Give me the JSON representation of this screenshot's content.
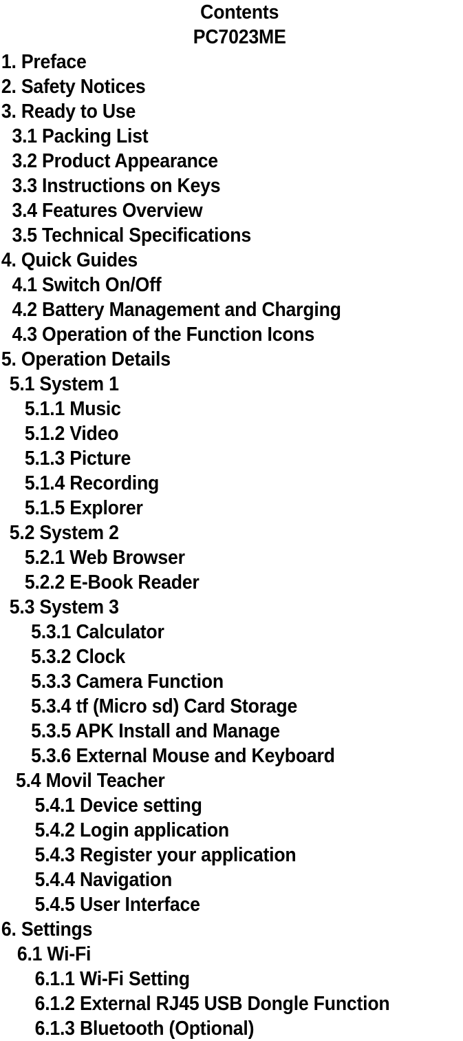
{
  "document": {
    "title": "Contents",
    "model": "PC7023ME"
  },
  "toc": {
    "entries": [
      {
        "label": "1. Preface",
        "indent": "lvl-0"
      },
      {
        "label": "2. Safety Notices",
        "indent": "lvl-0"
      },
      {
        "label": "3. Ready to Use",
        "indent": "lvl-0"
      },
      {
        "label": "3.1 Packing List",
        "indent": "lvl-1"
      },
      {
        "label": "3.2 Product Appearance",
        "indent": "lvl-1"
      },
      {
        "label": "3.3 Instructions on Keys",
        "indent": "lvl-1"
      },
      {
        "label": "3.4 Features Overview",
        "indent": "lvl-1"
      },
      {
        "label": "3.5 Technical Specifications",
        "indent": "lvl-1"
      },
      {
        "label": "4. Quick Guides",
        "indent": "lvl-0"
      },
      {
        "label": "4.1 Switch On/Off",
        "indent": "lvl-1"
      },
      {
        "label": "4.2 Battery Management and Charging",
        "indent": "lvl-1"
      },
      {
        "label": "4.3 Operation of the Function Icons",
        "indent": "lvl-1"
      },
      {
        "label": "5. Operation Details",
        "indent": "lvl-0"
      },
      {
        "label": "5.1 System 1",
        "indent": "lvl-1b"
      },
      {
        "label": "5.1.1 Music",
        "indent": "lvl-2"
      },
      {
        "label": "5.1.2 Video",
        "indent": "lvl-2"
      },
      {
        "label": "5.1.3 Picture",
        "indent": "lvl-2"
      },
      {
        "label": "5.1.4 Recording",
        "indent": "lvl-2"
      },
      {
        "label": "5.1.5 Explorer",
        "indent": "lvl-2"
      },
      {
        "label": "5.2 System 2",
        "indent": "lvl-1b"
      },
      {
        "label": "5.2.1 Web Browser",
        "indent": "lvl-2"
      },
      {
        "label": "5.2.2 E-Book Reader",
        "indent": "lvl-2"
      },
      {
        "label": "5.3 System 3",
        "indent": "lvl-1b"
      },
      {
        "label": "5.3.1 Calculator",
        "indent": "lvl-2b"
      },
      {
        "label": "5.3.2 Clock",
        "indent": "lvl-2b"
      },
      {
        "label": "5.3.3 Camera Function",
        "indent": "lvl-2b"
      },
      {
        "label": "5.3.4 tf (Micro sd) Card Storage",
        "indent": "lvl-2b"
      },
      {
        "label": "5.3.5 APK Install and Manage",
        "indent": "lvl-2b"
      },
      {
        "label": "5.3.6 External Mouse and Keyboard",
        "indent": "lvl-2b"
      },
      {
        "label": "5.4 Movil Teacher",
        "indent": "lvl-1d"
      },
      {
        "label": "5.4.1 Device setting",
        "indent": "lvl-2c"
      },
      {
        "label": "5.4.2 Login application",
        "indent": "lvl-2c"
      },
      {
        "label": "5.4.3 Register your application",
        "indent": "lvl-2c"
      },
      {
        "label": "5.4.4 Navigation",
        "indent": "lvl-2c"
      },
      {
        "label": "5.4.5 User Interface",
        "indent": "lvl-2c"
      },
      {
        "label": "6. Settings",
        "indent": "lvl-0"
      },
      {
        "label": "6.1 Wi-Fi",
        "indent": "lvl-1c"
      },
      {
        "label": "6.1.1 Wi-Fi Setting",
        "indent": "lvl-2c"
      },
      {
        "label": "6.1.2 External RJ45 USB Dongle Function",
        "indent": "lvl-2c"
      },
      {
        "label": "6.1.3 Bluetooth (Optional)",
        "indent": "lvl-2c"
      }
    ]
  },
  "style": {
    "text_color": "#000000",
    "background_color": "#ffffff"
  }
}
